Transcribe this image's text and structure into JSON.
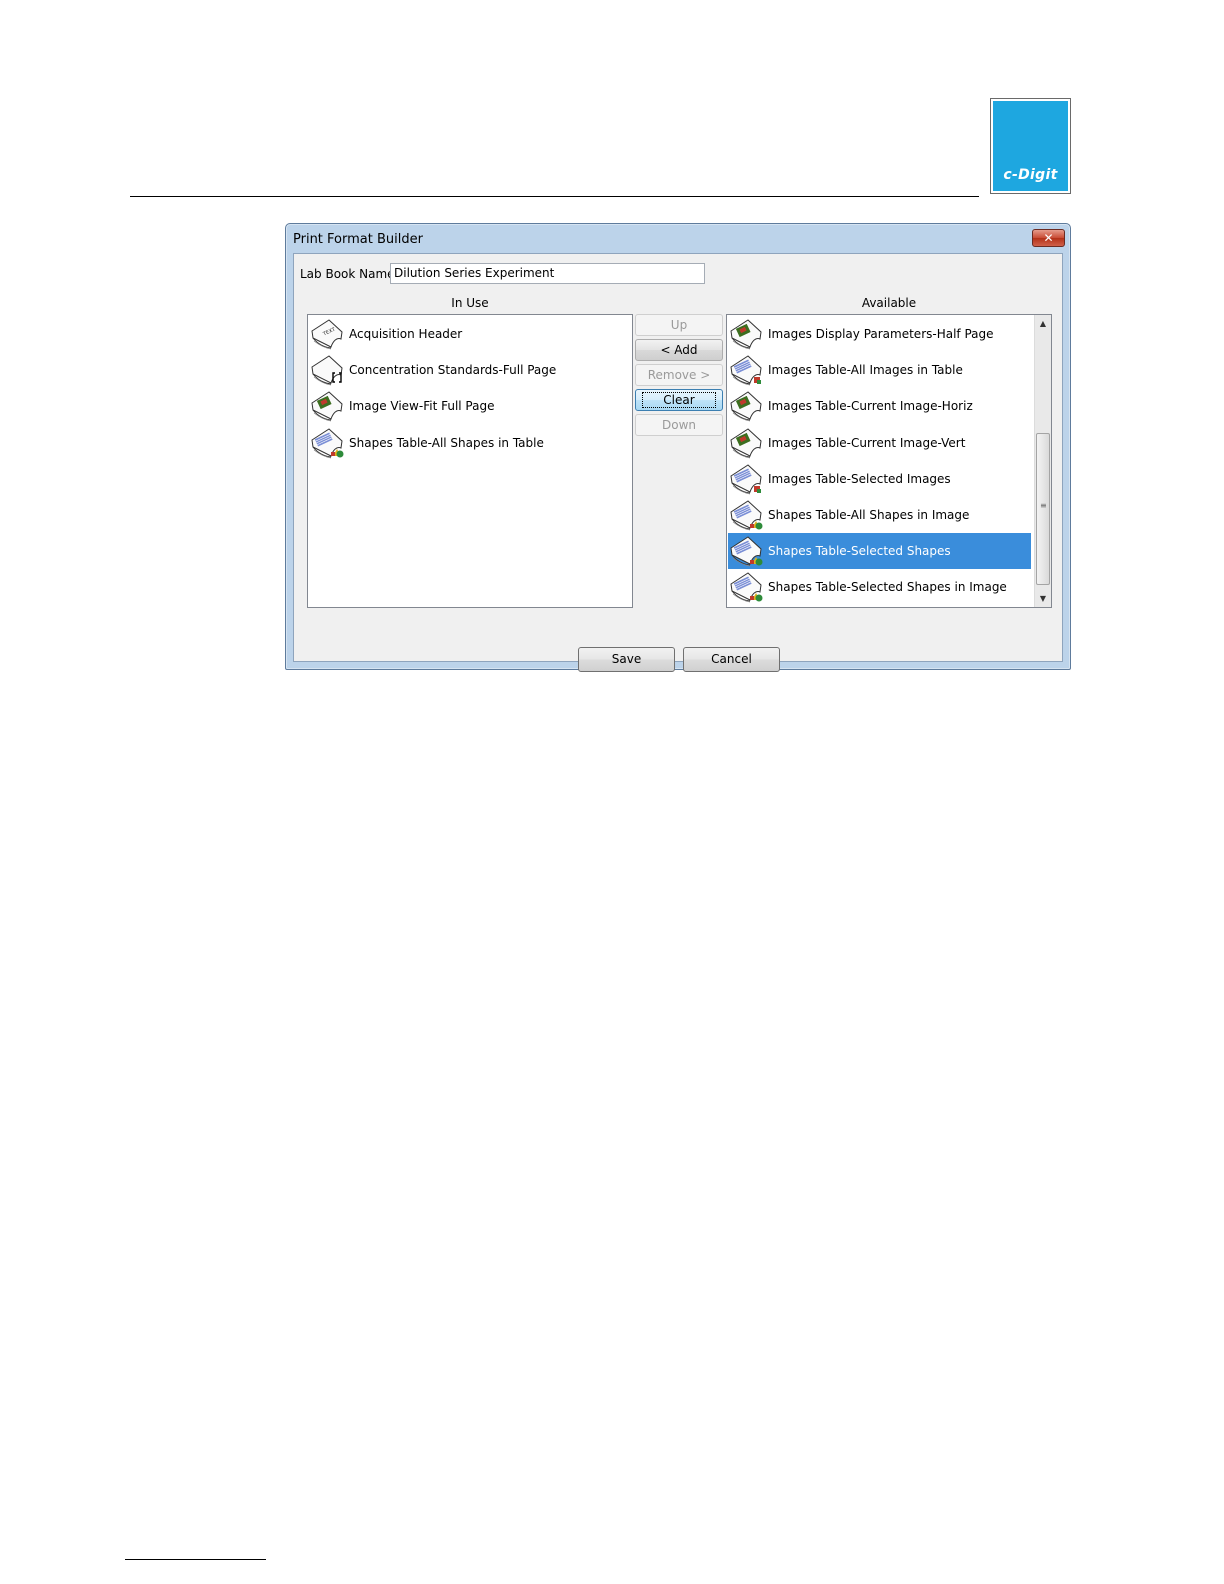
{
  "logo": {
    "text": "c-Digit"
  },
  "dialog": {
    "title": "Print Format Builder",
    "close_label": "✕",
    "lab_book_label": "Lab Book Name:",
    "lab_book_value": "Dilution Series Experiment",
    "in_use_header": "In Use",
    "available_header": "Available",
    "in_use_items": [
      {
        "label": "Acquisition Header",
        "icon": "header-report-icon"
      },
      {
        "label": "Concentration Standards-Full Page",
        "icon": "standards-report-icon"
      },
      {
        "label": "Image View-Fit Full Page",
        "icon": "image-report-icon"
      },
      {
        "label": "Shapes Table-All Shapes in Table",
        "icon": "shapes-table-report-icon"
      }
    ],
    "available_items": [
      {
        "label": "Images Display Parameters-Half Page",
        "icon": "image-report-icon"
      },
      {
        "label": "Images Table-All Images in Table",
        "icon": "images-table-report-icon"
      },
      {
        "label": "Images Table-Current Image-Horiz",
        "icon": "image-report-icon"
      },
      {
        "label": "Images Table-Current Image-Vert",
        "icon": "image-report-icon"
      },
      {
        "label": "Images Table-Selected Images",
        "icon": "images-table-report-icon"
      },
      {
        "label": "Shapes Table-All Shapes in Image",
        "icon": "shapes-table-report-icon"
      },
      {
        "label": "Shapes Table-Selected Shapes",
        "icon": "shapes-table-report-icon",
        "selected": true
      },
      {
        "label": "Shapes Table-Selected Shapes in Image",
        "icon": "shapes-table-report-icon"
      }
    ],
    "buttons": {
      "up": "Up",
      "add": "< Add",
      "remove": "Remove >",
      "clear": "Clear",
      "down": "Down",
      "save": "Save",
      "cancel": "Cancel"
    },
    "colors": {
      "selection": "#3a8ddb",
      "frame": "#bcd3ea"
    }
  }
}
